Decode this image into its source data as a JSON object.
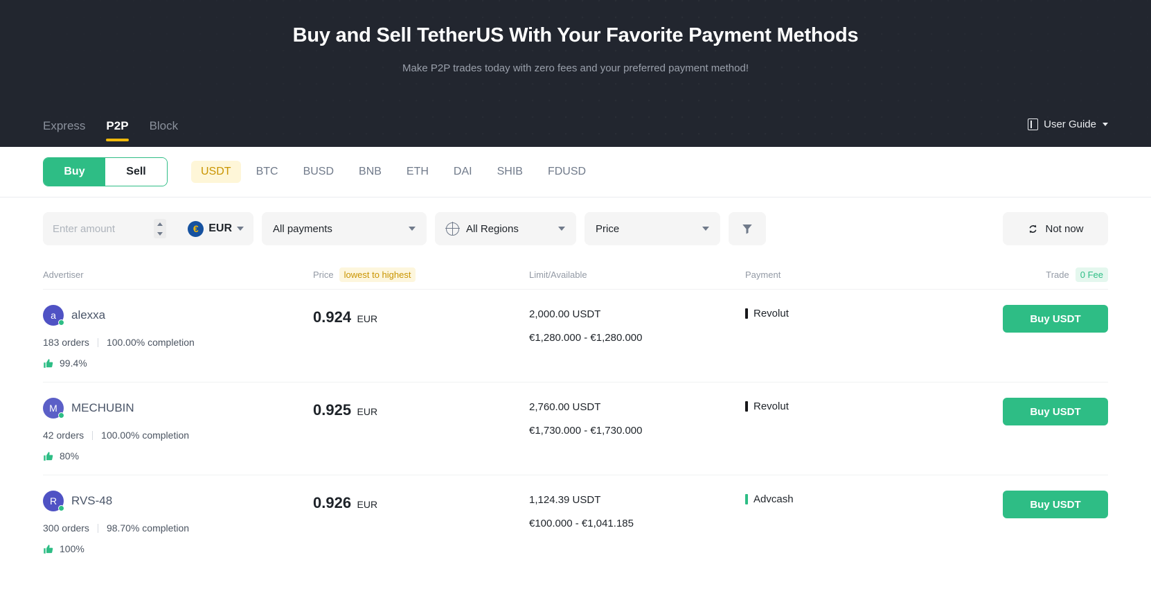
{
  "hero": {
    "title": "Buy and Sell TetherUS With Your Favorite Payment Methods",
    "subtitle": "Make P2P trades today with zero fees and your preferred payment method!",
    "tabs": [
      {
        "label": "Express",
        "active": false
      },
      {
        "label": "P2P",
        "active": true
      },
      {
        "label": "Block",
        "active": false
      }
    ],
    "user_guide": {
      "label": "User Guide",
      "icon": "book-icon",
      "caret": "chevron-down-icon"
    },
    "accent_color": "#f0b90b",
    "background_color": "#22262f"
  },
  "selector": {
    "side_toggle": [
      {
        "label": "Buy",
        "active": true
      },
      {
        "label": "Sell",
        "active": false
      }
    ],
    "coins": [
      {
        "label": "USDT",
        "active": true
      },
      {
        "label": "BTC",
        "active": false
      },
      {
        "label": "BUSD",
        "active": false
      },
      {
        "label": "BNB",
        "active": false
      },
      {
        "label": "ETH",
        "active": false
      },
      {
        "label": "DAI",
        "active": false
      },
      {
        "label": "SHIB",
        "active": false
      },
      {
        "label": "FDUSD",
        "active": false
      }
    ],
    "buy_color": "#2ebd85",
    "coin_active_color": "#c99400"
  },
  "filters": {
    "amount": {
      "value": "",
      "placeholder": "Enter amount"
    },
    "currency": {
      "code": "EUR",
      "symbol": "€"
    },
    "payments": {
      "value": "All payments"
    },
    "regions": {
      "value": "All Regions",
      "icon": "globe-icon"
    },
    "price": {
      "value": "Price"
    },
    "filter_icon": "funnel-icon",
    "refresh": {
      "label": "Not now",
      "icon": "refresh-icon"
    }
  },
  "table": {
    "headers": {
      "advertiser": "Advertiser",
      "price": "Price",
      "price_sort": "lowest to highest",
      "limit_available": "Limit/Available",
      "payment": "Payment",
      "trade": "Trade",
      "fee_badge": "0 Fee"
    },
    "rows": [
      {
        "avatar_letter": "a",
        "avatar_color": "#4f52c4",
        "name": "alexxa",
        "orders": "183 orders",
        "completion": "100.00% completion",
        "rating": "99.4%",
        "price": "0.924",
        "price_currency": "EUR",
        "limit": "2,000.00 USDT",
        "available": "€1,280.000 - €1,280.000",
        "payment": "Revolut",
        "payment_color": "#18181b",
        "action": "Buy USDT"
      },
      {
        "avatar_letter": "M",
        "avatar_color": "#5b5fc7",
        "name": "MECHUBIN",
        "orders": "42 orders",
        "completion": "100.00% completion",
        "rating": "80%",
        "price": "0.925",
        "price_currency": "EUR",
        "limit": "2,760.00 USDT",
        "available": "€1,730.000 - €1,730.000",
        "payment": "Revolut",
        "payment_color": "#18181b",
        "action": "Buy USDT"
      },
      {
        "avatar_letter": "R",
        "avatar_color": "#4f52c4",
        "name": "RVS-48",
        "orders": "300 orders",
        "completion": "98.70% completion",
        "rating": "100%",
        "price": "0.926",
        "price_currency": "EUR",
        "limit": "1,124.39 USDT",
        "available": "€100.000 - €1,041.185",
        "payment": "Advcash",
        "payment_color": "#2ebd85",
        "action": "Buy USDT"
      }
    ]
  }
}
